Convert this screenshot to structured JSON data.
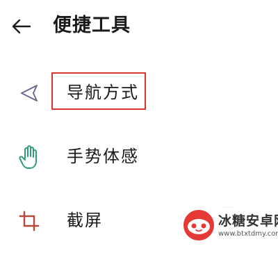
{
  "header": {
    "title": "便捷工具",
    "back_icon": "back-arrow-icon"
  },
  "menu": {
    "items": [
      {
        "label": "导航方式",
        "icon": "navigation-arrow-icon",
        "highlighted": true
      },
      {
        "label": "手势体感",
        "icon": "hand-gesture-icon",
        "highlighted": false
      },
      {
        "label": "截屏",
        "icon": "crop-screenshot-icon",
        "highlighted": false
      }
    ]
  },
  "highlight_color": "#d9352c",
  "icon_colors": {
    "navigation": "#6a6e8c",
    "gesture": "#2e9e7a",
    "screenshot": "#b64a3a"
  },
  "watermark": {
    "name": "冰糖安卓网",
    "url": "www.btxtdmy.com"
  }
}
